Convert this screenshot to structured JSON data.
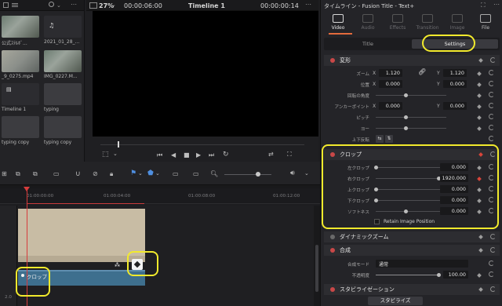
{
  "media_pool": {
    "items": [
      {
        "label": "公式ｽﾃﾙﾎﾞ..."
      },
      {
        "label": "2021_01_28_..."
      },
      {
        "label": "_9_0275.mp4"
      },
      {
        "label": "IMG_0227.M..."
      },
      {
        "label": "Timeline 1"
      },
      {
        "label": "typing"
      },
      {
        "label": "typing copy"
      },
      {
        "label": "typing copy"
      }
    ]
  },
  "viewer": {
    "zoom": "27%",
    "timecode_left": "00:00:06:00",
    "timeline_name": "Timeline 1",
    "timecode_right": "00:00:00:14"
  },
  "inspector": {
    "title": "タイムライン - Fusion Title - Text+",
    "tabs": [
      {
        "label": "Video"
      },
      {
        "label": "Audio"
      },
      {
        "label": "Effects"
      },
      {
        "label": "Transition"
      },
      {
        "label": "Image"
      },
      {
        "label": "File"
      }
    ],
    "subtabs": {
      "title": "Title",
      "settings": "Settings"
    },
    "transform": {
      "label": "変形",
      "zoom_label": "ズーム",
      "zoom_x": "1.120",
      "zoom_y": "1.120",
      "position_label": "位置",
      "position_x": "0.000",
      "position_y": "0.000",
      "rotation_label": "回転の角度",
      "anchor_label": "アンカーポイント",
      "anchor_x": "0.000",
      "anchor_y": "0.000",
      "pitch_label": "ピッチ",
      "yaw_label": "ヨー",
      "flip_label": "上下反転"
    },
    "crop": {
      "label": "クロップ",
      "left_label": "左クロップ",
      "left_value": "0.000",
      "right_label": "右クロップ",
      "right_value": "1920.000",
      "top_label": "上クロップ",
      "top_value": "0.000",
      "bottom_label": "下クロップ",
      "bottom_value": "0.000",
      "softness_label": "ソフトネス",
      "softness_value": "0.000",
      "retain_label": "Retain Image Position"
    },
    "dynamic_zoom": {
      "label": "ダイナミックズーム"
    },
    "composite": {
      "label": "合成",
      "mode_label": "合成モード",
      "mode_value": "通常",
      "opacity_label": "不透明度",
      "opacity_value": "100.00"
    },
    "stabilization": {
      "label": "スタビライゼーション",
      "button": "スタビライズ"
    }
  },
  "timeline": {
    "ruler": [
      "01:00:00:00",
      "01:00:04:00",
      "01:00:08:00",
      "01:00:12:00"
    ],
    "crop_clip_label": "クロップ",
    "track_label": "2.0"
  },
  "colors": {
    "highlight": "#f2ea2c",
    "accent_red": "#d63c3c",
    "title_clip": "#c8bca4",
    "crop_clip": "#3e6f8e"
  }
}
